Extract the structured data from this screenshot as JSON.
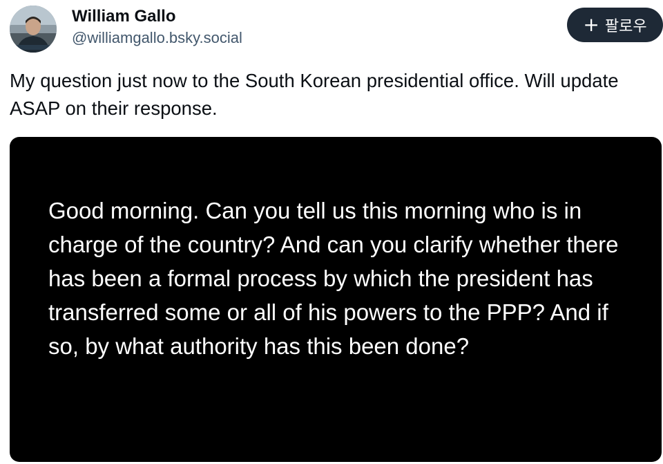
{
  "post": {
    "author": {
      "display_name": "William Gallo",
      "handle": "@williamgallo.bsky.social",
      "avatar_icon": "user-avatar"
    },
    "follow_button": {
      "icon": "plus-icon",
      "icon_glyph": "+",
      "label": "팔로우"
    },
    "text": "My question just now to the South Korean presidential office. Will update ASAP on their response.",
    "image": {
      "text": "Good morning. Can you tell us this morning who is in charge of the country? And can you clarify whether there has been a formal process by which the president has transferred some or all of his powers to the PPP? And if so, by what authority has this been done?",
      "background": "#000000"
    }
  },
  "colors": {
    "follow_button_bg": "#1e2936",
    "handle_text": "#42576c"
  }
}
